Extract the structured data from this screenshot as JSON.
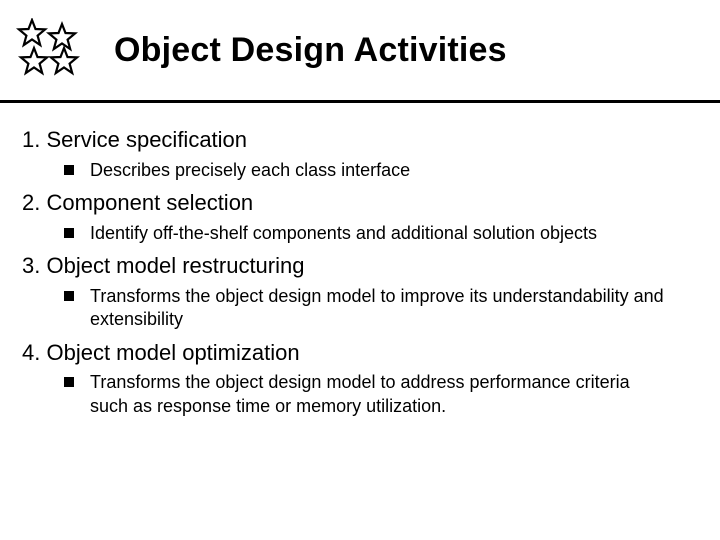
{
  "title": "Object Design Activities",
  "items": [
    {
      "num": "1.",
      "label": "Service specification",
      "sub": "Describes precisely each class interface"
    },
    {
      "num": "2.",
      "label": "Component selection",
      "sub": "Identify off-the-shelf components and additional solution objects"
    },
    {
      "num": "3.",
      "label": "Object model restructuring",
      "sub": "Transforms the object design model to improve its understandability and extensibility"
    },
    {
      "num": "4.",
      "label": "Object model optimization",
      "sub": "Transforms the object design model to address performance criteria such as response time or memory utilization."
    }
  ]
}
